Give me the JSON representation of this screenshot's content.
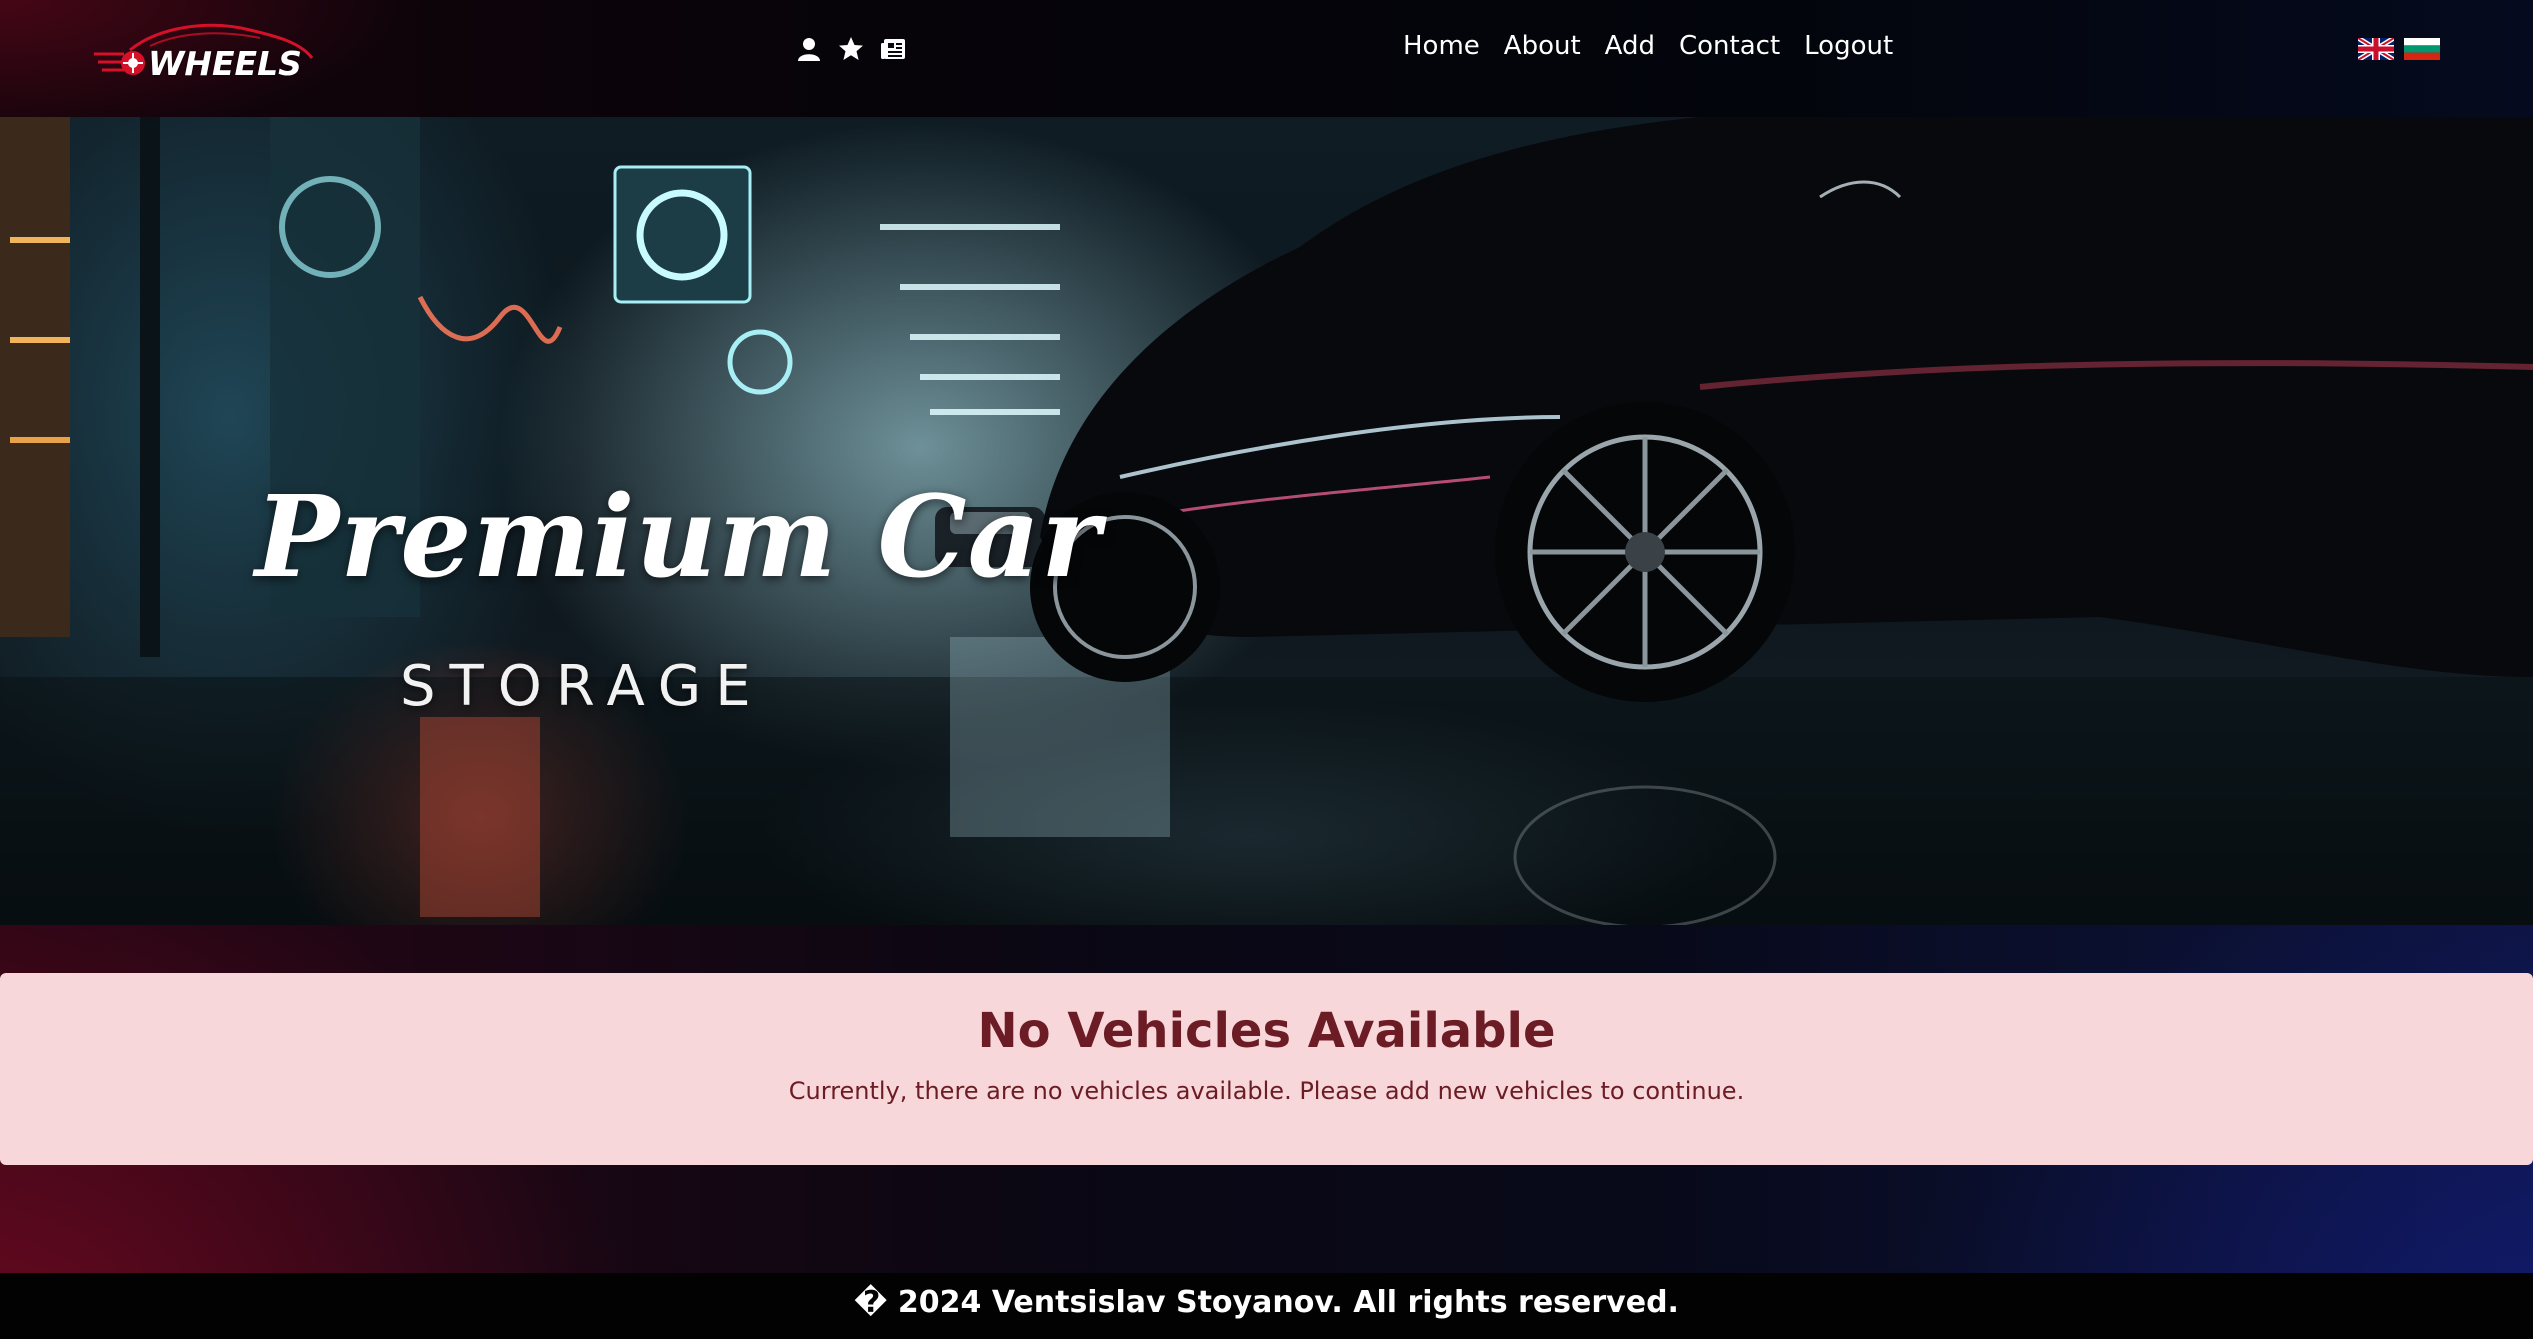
{
  "brand": {
    "name": "WHEELS",
    "logo_icon": "car-wheel-logo-icon",
    "accent_color": "#e0122b"
  },
  "nav_icons": [
    {
      "name": "user-icon"
    },
    {
      "name": "star-icon"
    },
    {
      "name": "newspaper-icon"
    }
  ],
  "nav": {
    "home": "Home",
    "about": "About",
    "add": "Add",
    "contact": "Contact",
    "logout": "Logout"
  },
  "language_flags": [
    {
      "name": "uk-flag-icon"
    },
    {
      "name": "bulgaria-flag-icon"
    }
  ],
  "hero": {
    "title": "Premium Car",
    "subtitle": "STORAGE",
    "image": "dark parking garage with black SUV and neon signs"
  },
  "alert": {
    "title": "No Vehicles Available",
    "message": "Currently, there are no vehicles available. Please add new vehicles to continue.",
    "background_color": "#f8d7da",
    "text_color": "#6b1c24"
  },
  "footer": {
    "text": "� 2024 Ventsislav Stoyanov. All rights reserved."
  }
}
